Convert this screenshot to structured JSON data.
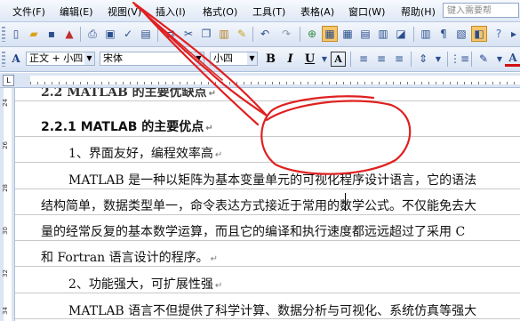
{
  "menu": {
    "items": [
      "文件(F)",
      "编辑(E)",
      "视图(V)",
      "插入(I)",
      "格式(O)",
      "工具(T)",
      "表格(A)",
      "窗口(W)",
      "帮助(H)"
    ],
    "help_placeholder": "键入需要帮"
  },
  "format_toolbar": {
    "style": "正文 + 小四",
    "font": "宋体",
    "size": "小四"
  },
  "ruler": {
    "v_numbers": [
      "24",
      "26",
      "28",
      "30",
      "32",
      "34"
    ]
  },
  "document": {
    "cut_heading": "2.2 MATLAB 的主要优缺点",
    "heading": "2.2.1 MATLAB 的主要优点",
    "point1": "1、界面友好，编程效率高",
    "para1_line1": "MATLAB 是一种以矩阵为基本变量单元的可视化程序设计语言，它的语法",
    "para1_line2": "结构简单，数据类型单一，命令表达方式接近于常用的数学公式。不仅能免去大",
    "para1_line3": "量的经常反复的基本数学运算，而且它的编译和执行速度都远远超过了采用 C",
    "para1_line4": "和 Fortran 语言设计的程序。",
    "point2": "2、功能强大，可扩展性强",
    "para2_line1": "MATLAB 语言不但提供了科学计算、数据分析与可视化、系统仿真等强大",
    "para_mark": "↵"
  },
  "colors": {
    "annotation": "#e02020",
    "menu_bg": "#dfe8f6",
    "highlight": "#f7c66a"
  }
}
